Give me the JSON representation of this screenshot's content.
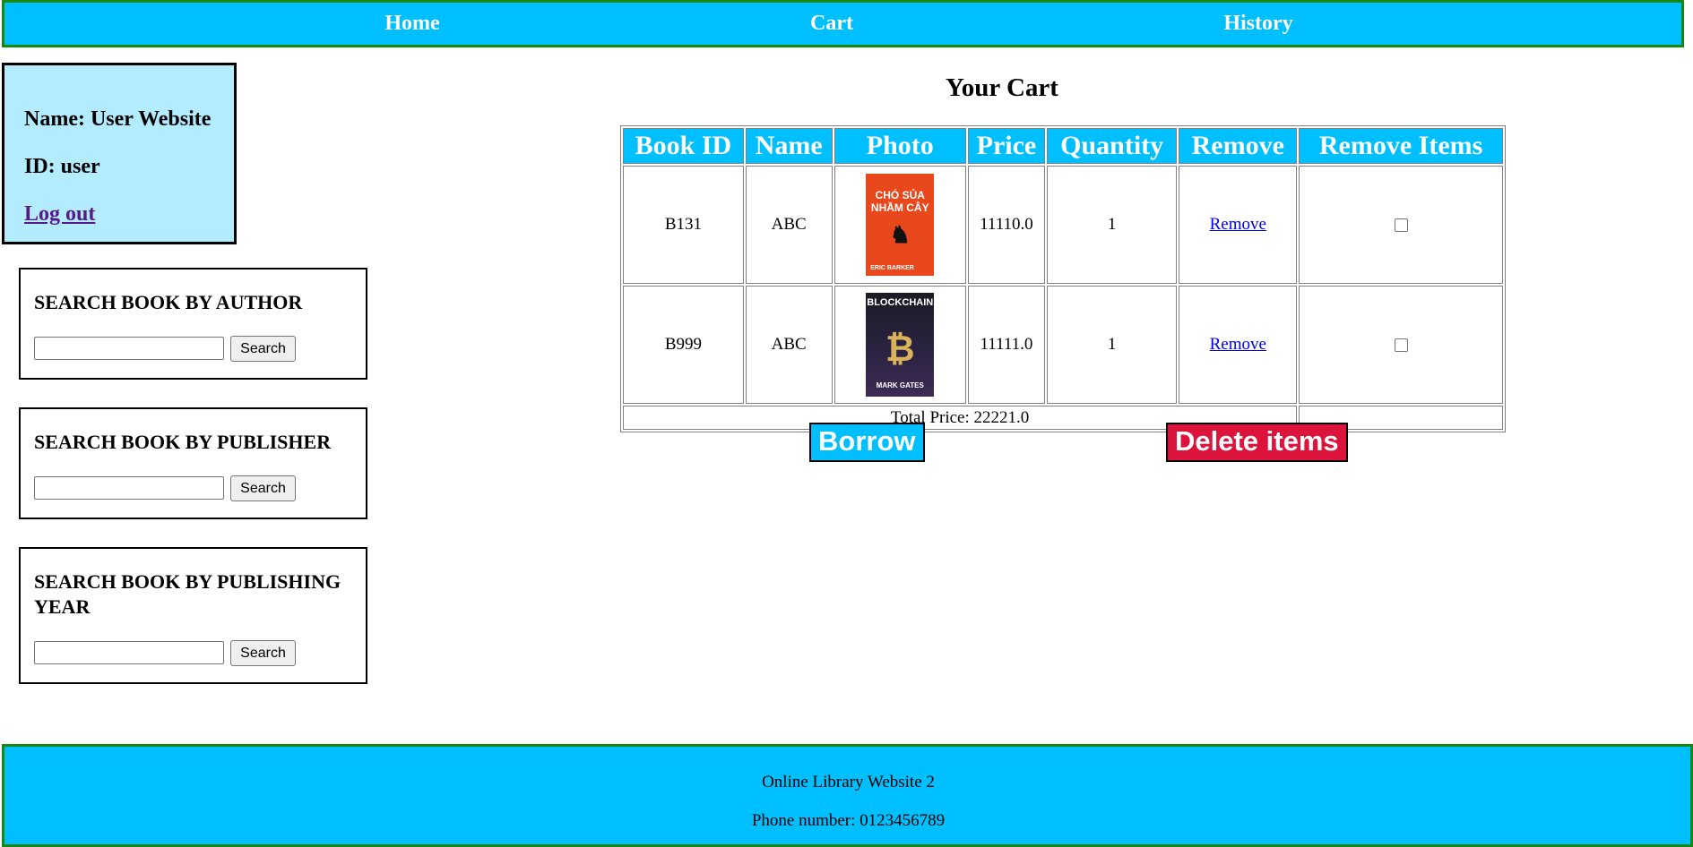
{
  "nav": {
    "home": "Home",
    "cart": "Cart",
    "history": "History"
  },
  "user": {
    "name_line": "Name: User Website",
    "id_line": "ID: user",
    "logout": "Log out"
  },
  "search": {
    "author_title": "SEARCH BOOK BY AUTHOR",
    "publisher_title": "SEARCH BOOK BY PUBLISHER",
    "year_title": "SEARCH BOOK BY PUBLISHING YEAR",
    "button_label": "Search",
    "author_value": "",
    "publisher_value": "",
    "year_value": ""
  },
  "cart": {
    "title": "Your Cart",
    "headers": [
      "Book ID",
      "Name",
      "Photo",
      "Price",
      "Quantity",
      "Remove",
      "Remove Items"
    ],
    "rows": [
      {
        "book_id": "B131",
        "name": "ABC",
        "photo": {
          "line1": "CHÓ SỦA",
          "line2": "NHẦM CÂY",
          "author": "ERIC BARKER",
          "color": "#e8481c"
        },
        "price": "11110.0",
        "quantity": "1",
        "remove": "Remove",
        "checked": false
      },
      {
        "book_id": "B999",
        "name": "ABC",
        "photo": {
          "line1": "BLOCKCHAIN",
          "line2": "₿",
          "author": "MARK GATES",
          "color": "#2a2340"
        },
        "price": "11111.0",
        "quantity": "1",
        "remove": "Remove",
        "checked": false
      }
    ],
    "total": "Total Price: 22221.0",
    "borrow_label": "Borrow",
    "delete_label": "Delete items"
  },
  "footer": {
    "site": "Online Library Website 2",
    "phone": "Phone number: 0123456789"
  },
  "colors": {
    "accent": "#00bfff",
    "border_green": "#148a14",
    "user_panel": "#b3ecff",
    "delete": "#dc143c"
  }
}
